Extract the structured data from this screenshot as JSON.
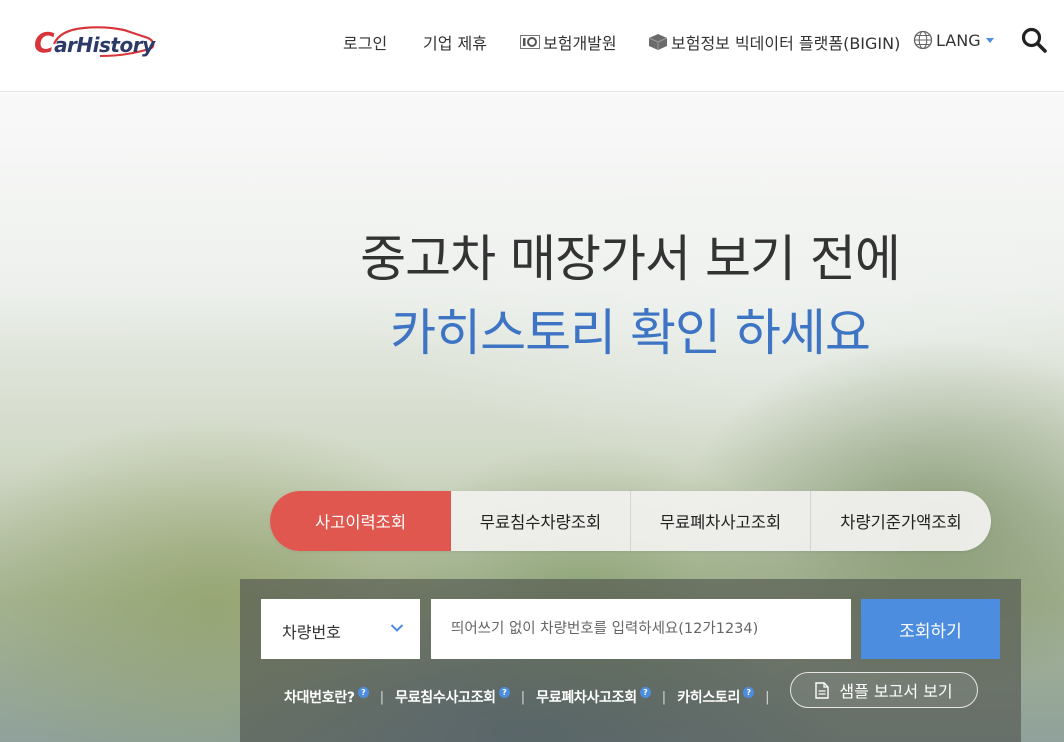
{
  "header": {
    "logo_text_c": "C",
    "logo_text_rest": "arHistory",
    "nav": {
      "login": "로그인",
      "partnership": "기업 제휴",
      "kidi": "보험개발원",
      "bigin": "보험정보 빅데이터 플랫폼(BIGIN)",
      "lang": "LANG"
    }
  },
  "hero": {
    "headline_line1": "중고차 매장가서 보기 전에",
    "headline_line2": "카히스토리 확인 하세요"
  },
  "tabs": [
    {
      "label": "사고이력조회",
      "active": true
    },
    {
      "label": "무료침수차량조회",
      "active": false
    },
    {
      "label": "무료폐차사고조회",
      "active": false
    },
    {
      "label": "차량기준가액조회",
      "active": false
    }
  ],
  "search": {
    "select_value": "차량번호",
    "input_placeholder": "띄어쓰기 없이 차량번호를 입력하세요(12가1234)",
    "submit_label": "조회하기"
  },
  "links": {
    "vin": "차대번호란?",
    "flood": "무료침수사고조회",
    "scrap": "무료폐차사고조회",
    "carhistory": "카히스토리",
    "help_mark": "?",
    "separator": "|"
  },
  "sample_button": "샘플 보고서 보기",
  "colors": {
    "accent_red": "#e0574f",
    "accent_blue": "#4d8de0",
    "headline_blue": "#3d74c4",
    "logo_navy": "#2b3a67",
    "logo_red": "#d8353b"
  },
  "icons": [
    "kidi-icon",
    "box-icon",
    "globe-icon",
    "caret-down-icon",
    "search-icon",
    "chevron-down-icon",
    "help-icon",
    "document-icon"
  ]
}
